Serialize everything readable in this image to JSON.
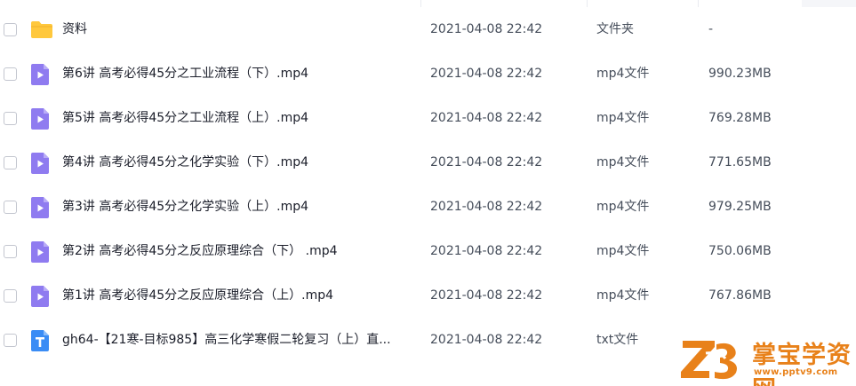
{
  "files": [
    {
      "icon": "folder-icon",
      "name": "资料",
      "modified": "2021-04-08 22:42",
      "type": "文件夹",
      "size": "-"
    },
    {
      "icon": "video-file-icon",
      "name": "第6讲 高考必得45分之工业流程（下）.mp4",
      "modified": "2021-04-08 22:42",
      "type": "mp4文件",
      "size": "990.23MB"
    },
    {
      "icon": "video-file-icon",
      "name": "第5讲 高考必得45分之工业流程（上）.mp4",
      "modified": "2021-04-08 22:42",
      "type": "mp4文件",
      "size": "769.28MB"
    },
    {
      "icon": "video-file-icon",
      "name": "第4讲 高考必得45分之化学实验（下）.mp4",
      "modified": "2021-04-08 22:42",
      "type": "mp4文件",
      "size": "771.65MB"
    },
    {
      "icon": "video-file-icon",
      "name": "第3讲 高考必得45分之化学实验（上）.mp4",
      "modified": "2021-04-08 22:42",
      "type": "mp4文件",
      "size": "979.25MB"
    },
    {
      "icon": "video-file-icon",
      "name": "第2讲 高考必得45分之反应原理综合（下） .mp4",
      "modified": "2021-04-08 22:42",
      "type": "mp4文件",
      "size": "750.06MB"
    },
    {
      "icon": "video-file-icon",
      "name": "第1讲 高考必得45分之反应原理综合（上）.mp4",
      "modified": "2021-04-08 22:42",
      "type": "mp4文件",
      "size": "767.86MB"
    },
    {
      "icon": "text-file-icon",
      "name": "gh64-【21寒-目标985】高三化学寒假二轮复习（上）直...",
      "modified": "2021-04-08 22:42",
      "type": "txt文件",
      "size": ""
    }
  ],
  "watermark": {
    "title": "掌宝学资网",
    "url": "www.pptv9.com"
  },
  "colors": {
    "folder": "#ffc83d",
    "video": "#8f7bf0",
    "text": "#3a8cf5",
    "watermark": "#e8811a"
  }
}
